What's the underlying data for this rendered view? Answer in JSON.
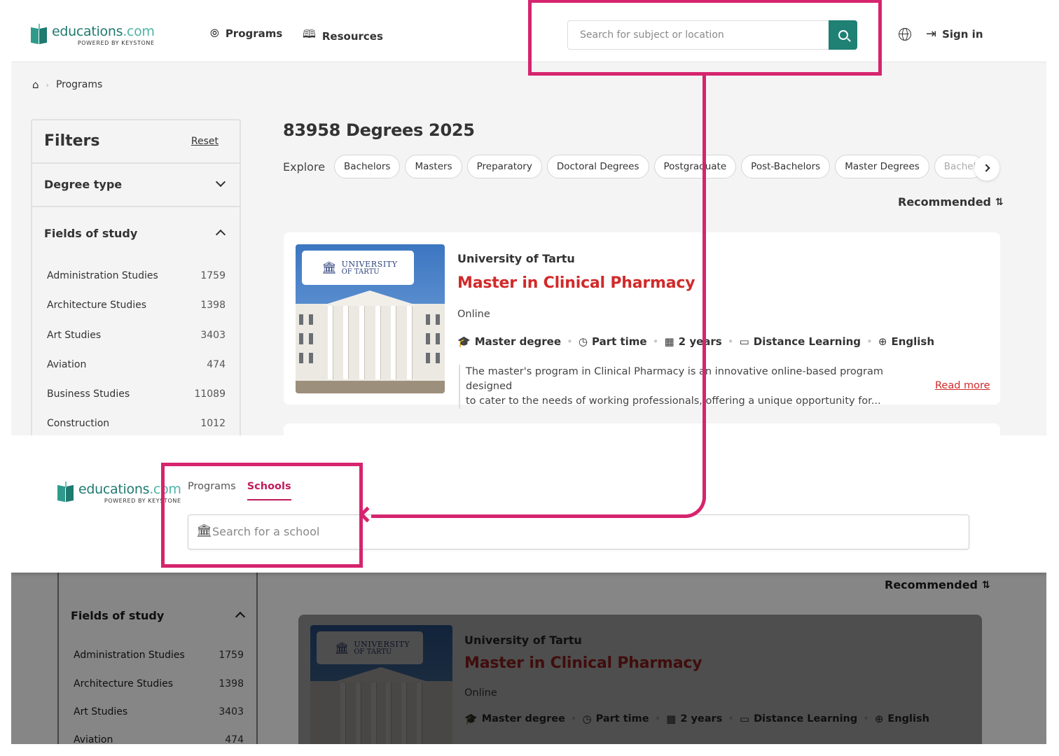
{
  "brand": {
    "name": "educations",
    "tld": ".com",
    "tagline": "POWERED BY KEYSTONE"
  },
  "nav": {
    "programs_label": "Programs",
    "resources_label": "Resources",
    "search_placeholder": "Search for subject or location",
    "signin_label": "Sign in"
  },
  "breadcrumb": {
    "current": "Programs"
  },
  "filters": {
    "title": "Filters",
    "reset_label": "Reset",
    "degree_type_label": "Degree type",
    "fields_of_study_label": "Fields of study",
    "fields": [
      {
        "name": "Administration Studies",
        "count": "1759"
      },
      {
        "name": "Architecture Studies",
        "count": "1398"
      },
      {
        "name": "Art Studies",
        "count": "3403"
      },
      {
        "name": "Aviation",
        "count": "474"
      },
      {
        "name": "Business Studies",
        "count": "11089"
      },
      {
        "name": "Construction",
        "count": "1012"
      }
    ]
  },
  "results": {
    "title": "83958 Degrees 2025",
    "explore_label": "Explore",
    "chips": [
      "Bachelors",
      "Masters",
      "Preparatory",
      "Doctoral Degrees",
      "Postgraduate",
      "Post-Bachelors",
      "Master Degrees",
      "Bachel"
    ],
    "sort_label": "Recommended"
  },
  "program_card": {
    "university": "University of Tartu",
    "logo_line1": "UNIVERSITY",
    "logo_line2": "OF TARTU",
    "title": "Master in Clinical Pharmacy",
    "mode": "Online",
    "degree": "Master degree",
    "pace": "Part time",
    "duration": "2 years",
    "format": "Distance Learning",
    "language": "English",
    "description_line1": "The master's program in Clinical Pharmacy is an innovative online-based program designed",
    "description_line2": "to cater to the needs of working professionals, offering a unique opportunity for...",
    "read_more": "Read more"
  },
  "overlay": {
    "tab_programs": "Programs",
    "tab_schools": "Schools",
    "school_search_placeholder": "Search for a school"
  },
  "colors": {
    "brand_teal": "#1f8074",
    "title_red": "#d12a2a",
    "annotation_pink": "#d6246e",
    "active_tab": "#c01c5d"
  }
}
